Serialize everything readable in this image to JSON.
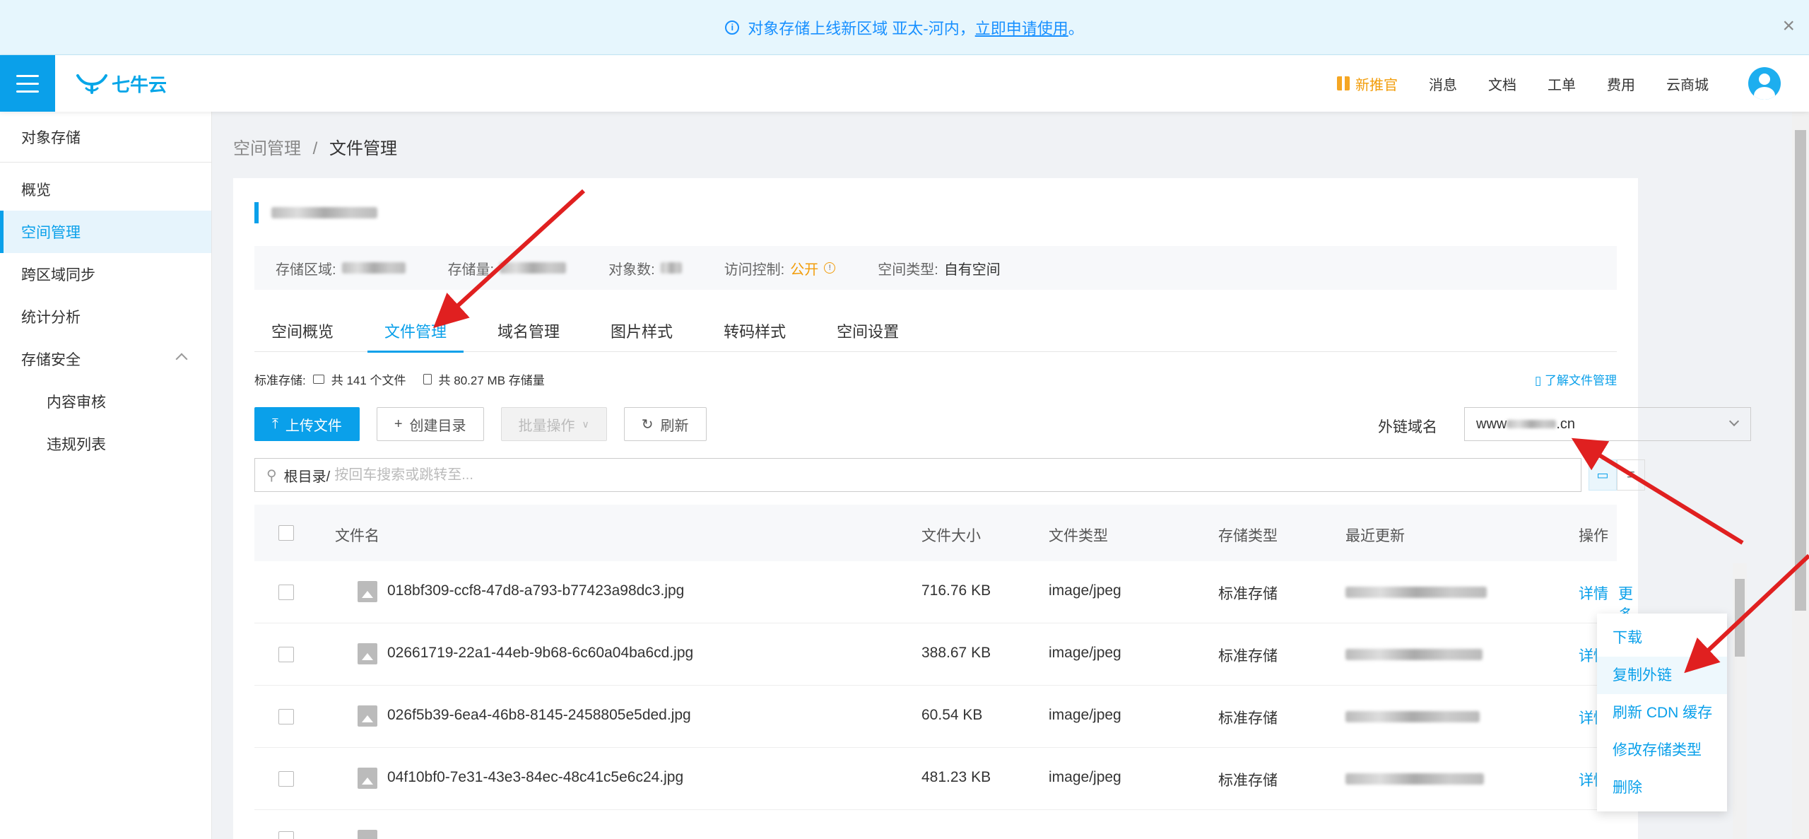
{
  "banner": {
    "text": "对象存储上线新区域 亚太-河内，",
    "link": "立即申请使用",
    "suffix": "。"
  },
  "header": {
    "logo": "七牛云",
    "nav": [
      "新推官",
      "消息",
      "文档",
      "工单",
      "费用",
      "云商城"
    ]
  },
  "sidebar": {
    "title": "对象存储",
    "items": [
      "概览",
      "空间管理",
      "跨区域同步",
      "统计分析",
      "存储安全"
    ],
    "sub_items": [
      "内容审核",
      "违规列表"
    ]
  },
  "breadcrumb": {
    "parent": "空间管理",
    "sep": "/",
    "current": "文件管理"
  },
  "info": {
    "region_label": "存储区域:",
    "storage_label": "存储量:",
    "objects_label": "对象数:",
    "access_label": "访问控制:",
    "access_value": "公开",
    "type_label": "空间类型:",
    "type_value": "自有空间"
  },
  "tabs": [
    "空间概览",
    "文件管理",
    "域名管理",
    "图片样式",
    "转码样式",
    "空间设置"
  ],
  "stats": {
    "label": "标准存储:",
    "files": "共 141 个文件",
    "size": "共 80.27 MB 存储量"
  },
  "learn_link": "了解文件管理",
  "toolbar": {
    "upload": "上传文件",
    "mkdir": "创建目录",
    "batch": "批量操作",
    "refresh": "刷新"
  },
  "domain": {
    "label": "外链域名",
    "value_prefix": "www",
    "value_suffix": ".cn"
  },
  "search": {
    "root": "根目录/",
    "placeholder": "按回车搜索或跳转至..."
  },
  "table": {
    "headers": [
      "文件名",
      "文件大小",
      "文件类型",
      "存储类型",
      "最近更新",
      "操作"
    ],
    "rows": [
      {
        "name": "018bf309-ccf8-47d8-a793-b77423a98dc3.jpg",
        "size": "716.76 KB",
        "type": "image/jpeg",
        "storage": "标准存储",
        "detail": "详情",
        "more": "更多"
      },
      {
        "name": "02661719-22a1-44eb-9b68-6c60a04ba6cd.jpg",
        "size": "388.67 KB",
        "type": "image/jpeg",
        "storage": "标准存储",
        "detail": "详情"
      },
      {
        "name": "026f5b39-6ea4-46b8-8145-2458805e5ded.jpg",
        "size": "60.54 KB",
        "type": "image/jpeg",
        "storage": "标准存储",
        "detail": "详情"
      },
      {
        "name": "04f10bf0-7e31-43e3-84ec-48c41c5e6c24.jpg",
        "size": "481.23 KB",
        "type": "image/jpeg",
        "storage": "标准存储",
        "detail": "详情"
      }
    ]
  },
  "dropdown": [
    "下载",
    "复制外链",
    "刷新 CDN 缓存",
    "修改存储类型",
    "删除"
  ],
  "colors": {
    "accent": "#0aa0ea",
    "warning": "#f29d0b",
    "annotation": "#e02020"
  }
}
